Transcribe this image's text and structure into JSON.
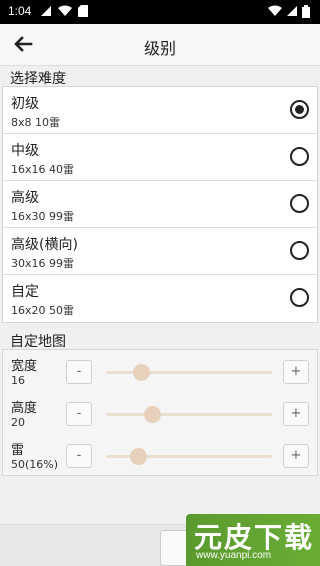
{
  "status_bar": {
    "time": "1:04",
    "icons": [
      "signal-icon",
      "wifi-icon",
      "sd-card-icon",
      "wifi-icon",
      "cell-signal-icon",
      "battery-icon"
    ]
  },
  "app_bar": {
    "title": "级别",
    "back_icon": "back-arrow-icon"
  },
  "difficulty": {
    "label": "选择难度",
    "items": [
      {
        "name": "初级",
        "detail": "8x8  10雷",
        "selected": true
      },
      {
        "name": "中级",
        "detail": "16x16  40雷",
        "selected": false
      },
      {
        "name": "高级",
        "detail": "16x30  99雷",
        "selected": false
      },
      {
        "name": "高级(横向)",
        "detail": "30x16  99雷",
        "selected": false
      },
      {
        "name": "自定",
        "detail": "16x20  50雷",
        "selected": false
      }
    ]
  },
  "custom_map": {
    "label": "自定地图",
    "rows": [
      {
        "name": "宽度",
        "value": "16",
        "minus": "-",
        "plus": "+",
        "level": 0.21
      },
      {
        "name": "高度",
        "value": "20",
        "minus": "-",
        "plus": "+",
        "level": 0.28
      },
      {
        "name": "雷",
        "value": "50(16%)",
        "minus": "-",
        "plus": "+",
        "level": 0.19
      }
    ]
  },
  "watermark": {
    "main": "元皮下载",
    "url": "www.yuanpi.com"
  }
}
